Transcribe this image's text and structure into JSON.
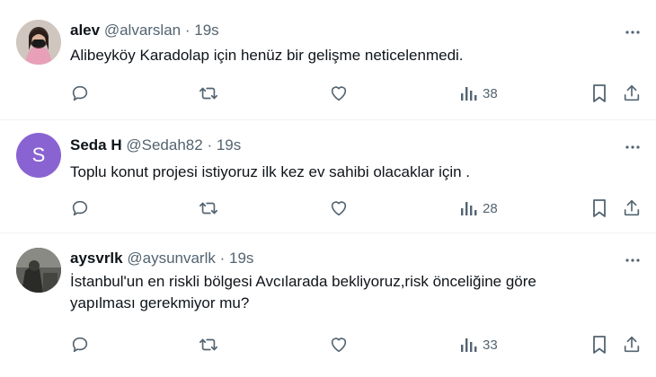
{
  "tweets": [
    {
      "name": "alev",
      "handle": "@alvarslan",
      "dot": "·",
      "time": "19s",
      "text": "Alibeyköy Karadolap için henüz bir gelişme neticelenmedi.",
      "views": "38",
      "avatar_type": "photo-woman-mask"
    },
    {
      "name": "Seda H",
      "handle": "@Sedah82",
      "dot": "·",
      "time": "19s",
      "text": "Toplu konut projesi istiyoruz ilk kez ev sahibi olacaklar için .",
      "views": "28",
      "avatar_type": "letter",
      "avatar_letter": "S",
      "avatar_color": "#8a63d2"
    },
    {
      "name": "aysvrlk",
      "handle": "@aysunvarlk",
      "dot": "·",
      "time": "19s",
      "text_line1": "İstanbul'un en riskli bölgesi Avcılarada bekliyoruz,risk önceliğine göre",
      "text_line2": "yapılması gerekmiyor mu?",
      "views": "33",
      "avatar_type": "photo-dark"
    }
  ],
  "icons": {
    "more": "more-horizontal-icon",
    "reply": "reply-icon",
    "retweet": "retweet-icon",
    "like": "like-icon",
    "views": "views-icon",
    "bookmark": "bookmark-icon",
    "share": "share-icon"
  },
  "colors": {
    "secondary_text": "#536471",
    "primary_text": "#0f1419",
    "divider": "#eff3f4"
  }
}
